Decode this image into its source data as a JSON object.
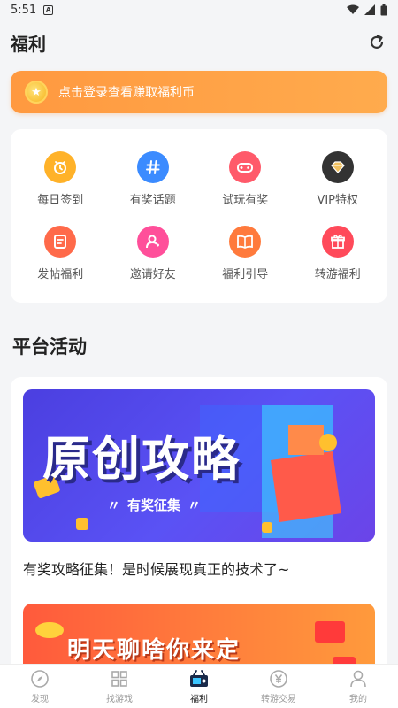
{
  "status": {
    "time": "5:51",
    "notif_glyph": "A"
  },
  "header": {
    "title": "福利"
  },
  "login": {
    "text": "点击登录查看赚取福利币"
  },
  "grid": [
    {
      "label": "每日签到",
      "icon": "daily-signin-icon",
      "color": "#ffb229"
    },
    {
      "label": "有奖话题",
      "icon": "hashtag-icon",
      "color": "#3b8bff"
    },
    {
      "label": "试玩有奖",
      "icon": "gamepad-icon",
      "color": "#ff5a6a"
    },
    {
      "label": "VIP特权",
      "icon": "vip-diamond-icon",
      "color": "#333333"
    },
    {
      "label": "发帖福利",
      "icon": "post-icon",
      "color": "#ff6a4a"
    },
    {
      "label": "邀请好友",
      "icon": "invite-friend-icon",
      "color": "#ff4f9a"
    },
    {
      "label": "福利引导",
      "icon": "guide-book-icon",
      "color": "#ff7a3c"
    },
    {
      "label": "转游福利",
      "icon": "gift-icon",
      "color": "#ff4a5a"
    }
  ],
  "section": {
    "title": "平台活动"
  },
  "activity": {
    "banner_title": "原创攻略",
    "banner_tag": "有奖征集",
    "caption": "有奖攻略征集！是时候展现真正的技术了~",
    "banner2_title": "明天聊啥你来定"
  },
  "tabs": [
    {
      "label": "发现",
      "icon": "compass-icon"
    },
    {
      "label": "找游戏",
      "icon": "grid-icon"
    },
    {
      "label": "福利",
      "icon": "welfare-icon",
      "active": true
    },
    {
      "label": "转游交易",
      "icon": "yen-exchange-icon"
    },
    {
      "label": "我的",
      "icon": "profile-icon"
    }
  ]
}
